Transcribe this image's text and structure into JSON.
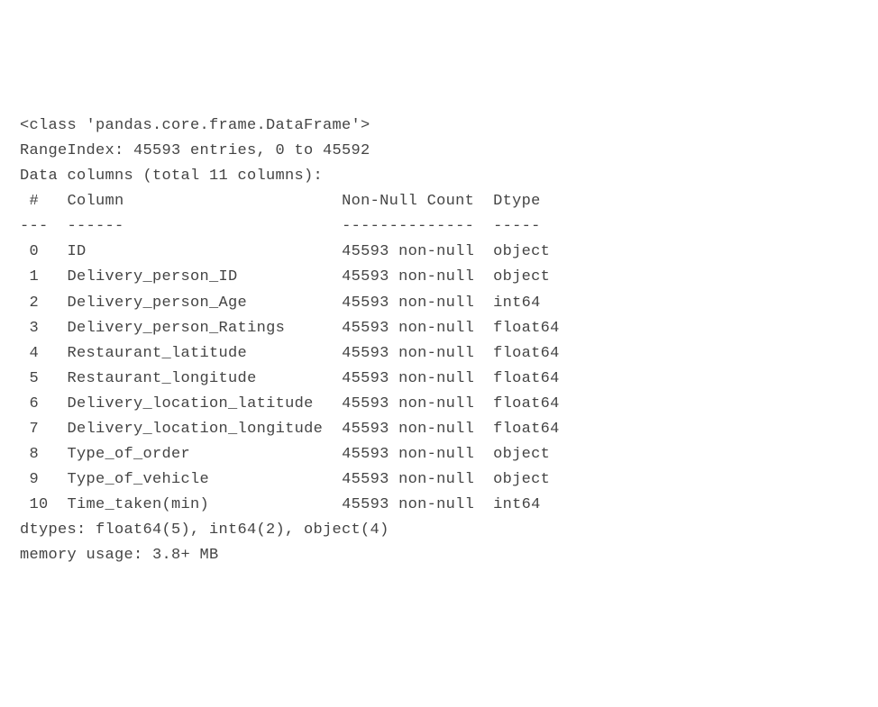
{
  "info": {
    "class_line": "<class 'pandas.core.frame.DataFrame'>",
    "range_index": "RangeIndex: 45593 entries, 0 to 45592",
    "data_columns_header": "Data columns (total 11 columns):",
    "header_idx": " #",
    "header_col": "Column",
    "header_nn": "Non-Null Count",
    "header_dtype": "Dtype",
    "divider_idx": "---",
    "divider_col": "------",
    "divider_nn": "--------------",
    "divider_dtype": "-----",
    "rows": [
      {
        "idx": " 0",
        "col": "ID",
        "nn": "45593 non-null",
        "dtype": "object"
      },
      {
        "idx": " 1",
        "col": "Delivery_person_ID",
        "nn": "45593 non-null",
        "dtype": "object"
      },
      {
        "idx": " 2",
        "col": "Delivery_person_Age",
        "nn": "45593 non-null",
        "dtype": "int64"
      },
      {
        "idx": " 3",
        "col": "Delivery_person_Ratings",
        "nn": "45593 non-null",
        "dtype": "float64"
      },
      {
        "idx": " 4",
        "col": "Restaurant_latitude",
        "nn": "45593 non-null",
        "dtype": "float64"
      },
      {
        "idx": " 5",
        "col": "Restaurant_longitude",
        "nn": "45593 non-null",
        "dtype": "float64"
      },
      {
        "idx": " 6",
        "col": "Delivery_location_latitude",
        "nn": "45593 non-null",
        "dtype": "float64"
      },
      {
        "idx": " 7",
        "col": "Delivery_location_longitude",
        "nn": "45593 non-null",
        "dtype": "float64"
      },
      {
        "idx": " 8",
        "col": "Type_of_order",
        "nn": "45593 non-null",
        "dtype": "object"
      },
      {
        "idx": " 9",
        "col": "Type_of_vehicle",
        "nn": "45593 non-null",
        "dtype": "object"
      },
      {
        "idx": " 10",
        "col": "Time_taken(min)",
        "nn": "45593 non-null",
        "dtype": "int64"
      }
    ],
    "dtypes_line": "dtypes: float64(5), int64(2), object(4)",
    "memory_line": "memory usage: 3.8+ MB"
  }
}
